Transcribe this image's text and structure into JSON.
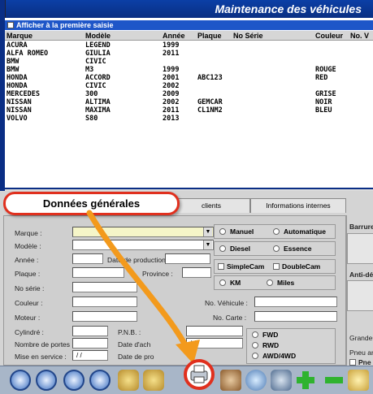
{
  "window": {
    "title": "Maintenance des véhicules"
  },
  "list": {
    "checkbox_label": "Afficher à la première saisie",
    "columns": [
      "Marque",
      "Modèle",
      "Année",
      "Plaque",
      "No Série",
      "Couleur",
      "No. V"
    ],
    "rows": [
      [
        "ACURA",
        "LEGEND",
        "1999",
        "",
        "",
        "",
        ""
      ],
      [
        "ALFA ROMEO",
        "GIULIA",
        "2011",
        "",
        "",
        "",
        ""
      ],
      [
        "BMW",
        "CIVIC",
        "",
        "",
        "",
        "",
        ""
      ],
      [
        "BMW",
        "M3",
        "1999",
        "",
        "",
        "ROUGE",
        ""
      ],
      [
        "HONDA",
        "ACCORD",
        "2001",
        "ABC123",
        "",
        "RED",
        ""
      ],
      [
        "HONDA",
        "CIVIC",
        "2002",
        "",
        "",
        "",
        ""
      ],
      [
        "MERCEDES",
        "300",
        "2009",
        "",
        "",
        "GRISE",
        ""
      ],
      [
        "NISSAN",
        "ALTIMA",
        "2002",
        "GEMCAR",
        "",
        "NOIR",
        ""
      ],
      [
        "NISSAN",
        "MAXIMA",
        "2011",
        "CL1NM2",
        "",
        "BLEU",
        ""
      ],
      [
        "VOLVO",
        "S80",
        "2013",
        "",
        "",
        "",
        ""
      ]
    ]
  },
  "tabs": {
    "callout": "Données générales",
    "clients": "clients",
    "informations_internes": "Informations internes"
  },
  "form": {
    "marque": "Marque :",
    "modele": "Modèle :",
    "annee": "Année :",
    "date_production": "Date de production :",
    "plaque": "Plaque :",
    "province": "Province :",
    "no_serie": "No série :",
    "couleur": "Couleur :",
    "no_vehicule": "No. Véhicule :",
    "moteur": "Moteur :",
    "no_carte": "No. Carte :",
    "cylindre": "Cylindré :",
    "pnb": "P.N.B. :",
    "nombre_portes": "Nombre de portes :",
    "date_achat": "Date d'ach",
    "date_achat_value": "/ /",
    "mise_en_service": "Mise en service :",
    "mise_en_service_value": "/ /",
    "date_pro": "Date de pro"
  },
  "options": {
    "manuel": "Manuel",
    "automatique": "Automatique",
    "diesel": "Diesel",
    "essence": "Essence",
    "simplecam": "SimpleCam",
    "doublecam": "DoubleCam",
    "km": "KM",
    "miles": "Miles",
    "fwd": "FWD",
    "rwd": "RWD",
    "awd": "AWD/4WD"
  },
  "side": {
    "barrure": "Barrure",
    "anti_dem": "Anti-dém",
    "grandeur": "Grandeur",
    "pneu": "Pneu arr",
    "pne1": "Pne",
    "pne2": "Pne"
  },
  "colors": {
    "title_bar": "#0b3fa6",
    "callout_border": "#e0301e",
    "arrow": "#f39a1c",
    "toolbar": "#a8b6c8"
  }
}
